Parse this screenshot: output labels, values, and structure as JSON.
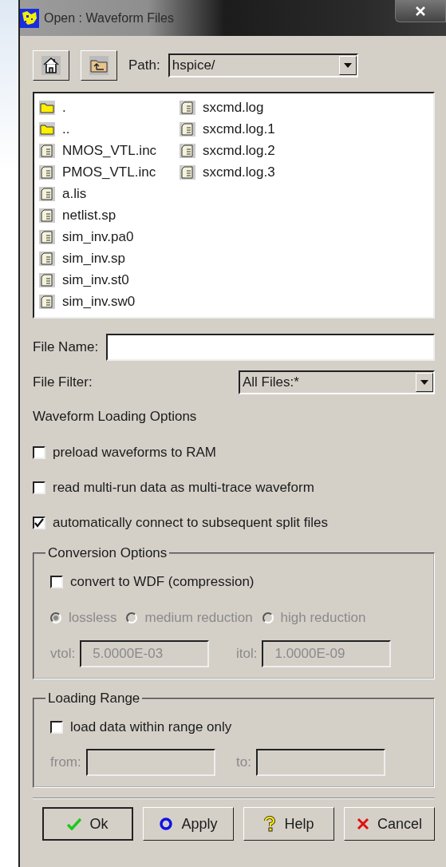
{
  "window": {
    "title": "Open : Waveform Files"
  },
  "toolbar": {
    "path_label": "Path:",
    "path": "hspice/"
  },
  "files": [
    {
      "name": ".",
      "kind": "folder"
    },
    {
      "name": "..",
      "kind": "folder"
    },
    {
      "name": "NMOS_VTL.inc",
      "kind": "file"
    },
    {
      "name": "PMOS_VTL.inc",
      "kind": "file"
    },
    {
      "name": "a.lis",
      "kind": "file"
    },
    {
      "name": "netlist.sp",
      "kind": "file"
    },
    {
      "name": "sim_inv.pa0",
      "kind": "file"
    },
    {
      "name": "sim_inv.sp",
      "kind": "file"
    },
    {
      "name": "sim_inv.st0",
      "kind": "file"
    },
    {
      "name": "sim_inv.sw0",
      "kind": "file"
    },
    {
      "name": "sxcmd.log",
      "kind": "file"
    },
    {
      "name": "sxcmd.log.1",
      "kind": "file"
    },
    {
      "name": "sxcmd.log.2",
      "kind": "file"
    },
    {
      "name": "sxcmd.log.3",
      "kind": "file"
    }
  ],
  "file_name": {
    "label": "File Name:"
  },
  "file_filter": {
    "label": "File Filter:",
    "value": "All Files:*"
  },
  "loading_options": {
    "title": "Waveform Loading Options",
    "options": [
      {
        "label": "preload waveforms to RAM",
        "checked": false
      },
      {
        "label": "read multi-run data as multi-trace waveform",
        "checked": false
      },
      {
        "label": "automatically connect to subsequent split files",
        "checked": true
      }
    ]
  },
  "conversion": {
    "title": "Conversion Options",
    "checkbox": {
      "label": "convert to WDF (compression)",
      "checked": false
    },
    "radios": [
      {
        "label": "lossless",
        "selected": true,
        "disabled": true
      },
      {
        "label": "medium reduction",
        "selected": false,
        "disabled": true
      },
      {
        "label": "high reduction",
        "selected": false,
        "disabled": true
      }
    ],
    "fields": [
      {
        "label": "vtol:",
        "value": "5.0000E-03",
        "disabled": true
      },
      {
        "label": "itol:",
        "value": "1.0000E-09",
        "disabled": true
      }
    ]
  },
  "loading_range": {
    "title": "Loading Range",
    "checkbox": {
      "label": "load data within range only",
      "checked": false
    },
    "fields": [
      {
        "label": "from:",
        "disabled": true
      },
      {
        "label": "to:",
        "disabled": true
      }
    ]
  },
  "buttons": [
    {
      "label": "Ok",
      "kind": "ok",
      "default": true
    },
    {
      "label": "Apply",
      "kind": "apply",
      "default": false
    },
    {
      "label": "Help",
      "kind": "help",
      "default": false
    },
    {
      "label": "Cancel",
      "kind": "cancel",
      "default": false
    }
  ]
}
